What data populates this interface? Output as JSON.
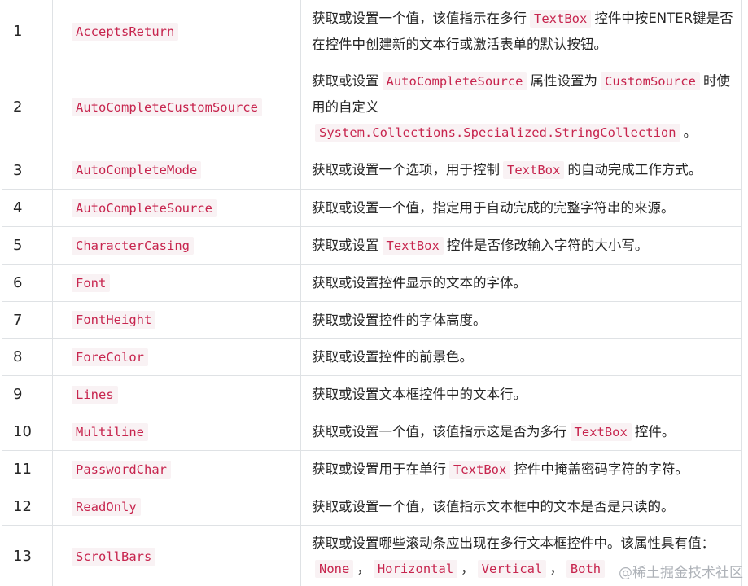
{
  "rows": [
    {
      "num": "1",
      "name": "AcceptsReturn",
      "desc": [
        {
          "t": "text",
          "v": "获取或设置一个值，该值指示在多行"
        },
        {
          "t": "code",
          "v": "TextBox"
        },
        {
          "t": "text",
          "v": "控件中按ENTER键是否在控件中创建新的文本行或激活表单的默认按钮。"
        }
      ]
    },
    {
      "num": "2",
      "name": "AutoCompleteCustomSource",
      "desc": [
        {
          "t": "text",
          "v": "获取或设置"
        },
        {
          "t": "code",
          "v": "AutoCompleteSource"
        },
        {
          "t": "text",
          "v": "属性设置为"
        },
        {
          "t": "code",
          "v": "CustomSource"
        },
        {
          "t": "text",
          "v": "时使用的自定义"
        },
        {
          "t": "code",
          "v": "System.Collections.Specialized.StringCollection"
        },
        {
          "t": "text",
          "v": "。"
        }
      ]
    },
    {
      "num": "3",
      "name": "AutoCompleteMode",
      "desc": [
        {
          "t": "text",
          "v": "获取或设置一个选项，用于控制"
        },
        {
          "t": "code",
          "v": "TextBox"
        },
        {
          "t": "text",
          "v": "的自动完成工作方式。"
        }
      ]
    },
    {
      "num": "4",
      "name": "AutoCompleteSource",
      "desc": [
        {
          "t": "text",
          "v": "获取或设置一个值，指定用于自动完成的完整字符串的来源。"
        }
      ]
    },
    {
      "num": "5",
      "name": "CharacterCasing",
      "desc": [
        {
          "t": "text",
          "v": "获取或设置"
        },
        {
          "t": "code",
          "v": "TextBox"
        },
        {
          "t": "text",
          "v": "控件是否修改输入字符的大小写。"
        }
      ]
    },
    {
      "num": "6",
      "name": "Font",
      "desc": [
        {
          "t": "text",
          "v": "获取或设置控件显示的文本的字体。"
        }
      ]
    },
    {
      "num": "7",
      "name": "FontHeight",
      "desc": [
        {
          "t": "text",
          "v": "获取或设置控件的字体高度。"
        }
      ]
    },
    {
      "num": "8",
      "name": "ForeColor",
      "desc": [
        {
          "t": "text",
          "v": "获取或设置控件的前景色。"
        }
      ]
    },
    {
      "num": "9",
      "name": "Lines",
      "desc": [
        {
          "t": "text",
          "v": "获取或设置文本框控件中的文本行。"
        }
      ]
    },
    {
      "num": "10",
      "name": "Multiline",
      "desc": [
        {
          "t": "text",
          "v": "获取或设置一个值，该值指示这是否为多行"
        },
        {
          "t": "code",
          "v": "TextBox"
        },
        {
          "t": "text",
          "v": "控件。"
        }
      ]
    },
    {
      "num": "11",
      "name": "PasswordChar",
      "desc": [
        {
          "t": "text",
          "v": "获取或设置用于在单行"
        },
        {
          "t": "code",
          "v": "TextBox"
        },
        {
          "t": "text",
          "v": "控件中掩盖密码字符的字符。"
        }
      ]
    },
    {
      "num": "12",
      "name": "ReadOnly",
      "desc": [
        {
          "t": "text",
          "v": "获取或设置一个值，该值指示文本框中的文本是否是只读的。"
        }
      ]
    },
    {
      "num": "13",
      "name": "ScrollBars",
      "desc": [
        {
          "t": "text",
          "v": "获取或设置哪些滚动条应出现在多行文本框控件中。该属性具有值："
        },
        {
          "t": "code",
          "v": "None"
        },
        {
          "t": "text",
          "v": "，"
        },
        {
          "t": "code",
          "v": "Horizontal"
        },
        {
          "t": "text",
          "v": "，"
        },
        {
          "t": "code",
          "v": "Vertical"
        },
        {
          "t": "text",
          "v": "，"
        },
        {
          "t": "code",
          "v": "Both"
        }
      ]
    }
  ],
  "watermark": "@稀土掘金技术社区",
  "colors": {
    "code_text": "#c7254e",
    "code_bg": "#f9f2f4",
    "border": "#dfe2e5",
    "text": "#262626"
  }
}
